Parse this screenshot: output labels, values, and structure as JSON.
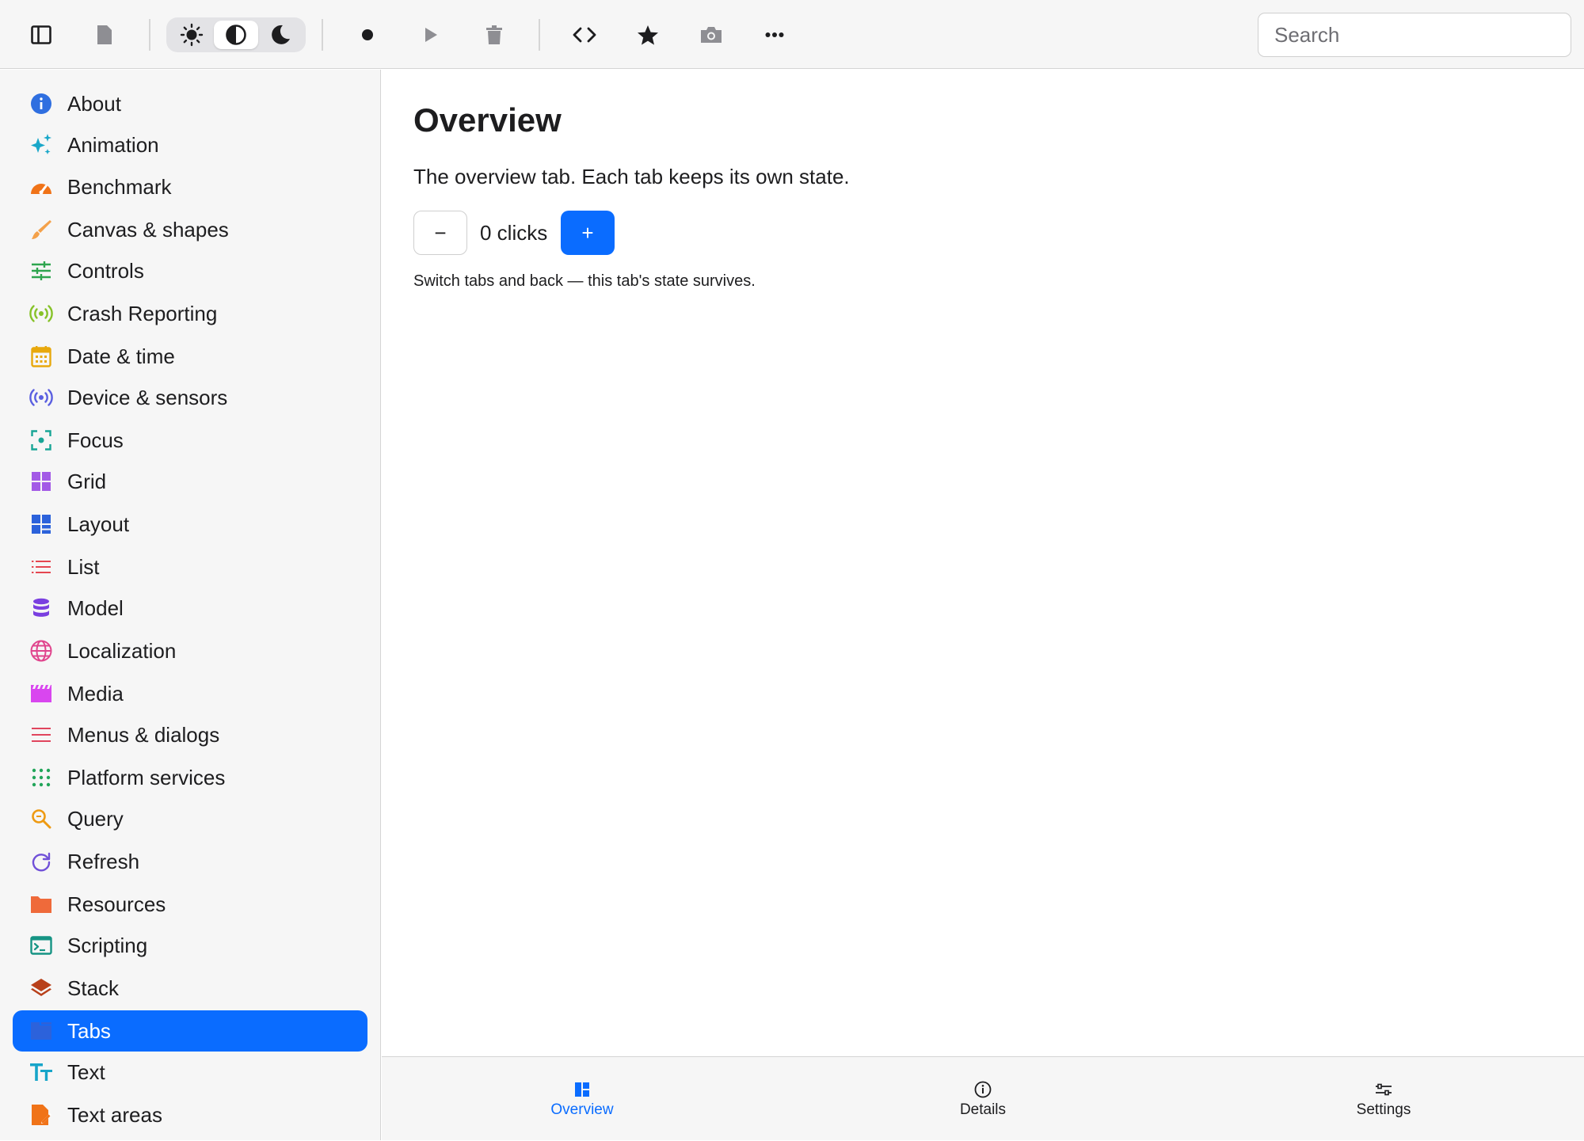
{
  "toolbar": {
    "icons": [
      "sidebar-toggle-icon",
      "document-icon",
      "sun-icon",
      "contrast-icon",
      "moon-icon",
      "record-icon",
      "play-icon",
      "trash-icon",
      "code-icon",
      "star-icon",
      "camera-icon",
      "more-icon"
    ],
    "appearance_selected": "contrast",
    "search_placeholder": "Search",
    "search_value": ""
  },
  "sidebar": {
    "selected": "Tabs",
    "items": [
      {
        "label": "About",
        "icon": "info-icon",
        "color": "#2f6fe0"
      },
      {
        "label": "Animation",
        "icon": "sparkles-icon",
        "color": "#19a7c9"
      },
      {
        "label": "Benchmark",
        "icon": "gauge-icon",
        "color": "#f07318"
      },
      {
        "label": "Canvas & shapes",
        "icon": "brush-icon",
        "color": "#f4a14a"
      },
      {
        "label": "Controls",
        "icon": "sliders-icon",
        "color": "#2ea54f"
      },
      {
        "label": "Crash Reporting",
        "icon": "antenna-icon",
        "color": "#86c228"
      },
      {
        "label": "Date & time",
        "icon": "calendar-icon",
        "color": "#e8a80c"
      },
      {
        "label": "Device & sensors",
        "icon": "sensor-icon",
        "color": "#5a5fe0"
      },
      {
        "label": "Focus",
        "icon": "focus-icon",
        "color": "#17a596"
      },
      {
        "label": "Grid",
        "icon": "grid-icon",
        "color": "#a35ae6"
      },
      {
        "label": "Layout",
        "icon": "layout-icon",
        "color": "#2c62db"
      },
      {
        "label": "List",
        "icon": "list-icon",
        "color": "#e54650"
      },
      {
        "label": "Model",
        "icon": "database-icon",
        "color": "#7a3fe0"
      },
      {
        "label": "Localization",
        "icon": "globe-icon",
        "color": "#e0458d"
      },
      {
        "label": "Media",
        "icon": "clapperboard-icon",
        "color": "#d946ef"
      },
      {
        "label": "Menus & dialogs",
        "icon": "menu-icon",
        "color": "#e0455d"
      },
      {
        "label": "Platform services",
        "icon": "dots-grid-icon",
        "color": "#22a55a"
      },
      {
        "label": "Query",
        "icon": "search-icon",
        "color": "#ee9a12"
      },
      {
        "label": "Refresh",
        "icon": "refresh-icon",
        "color": "#7050d8"
      },
      {
        "label": "Resources",
        "icon": "folder-icon",
        "color": "#ef6a3a"
      },
      {
        "label": "Scripting",
        "icon": "terminal-icon",
        "color": "#169484"
      },
      {
        "label": "Stack",
        "icon": "layers-icon",
        "color": "#b8401a"
      },
      {
        "label": "Tabs",
        "icon": "tabs-icon",
        "color": "#2c62db"
      },
      {
        "label": "Text",
        "icon": "text-icon",
        "color": "#17a5c9"
      },
      {
        "label": "Text areas",
        "icon": "document-edit-icon",
        "color": "#f07318"
      }
    ]
  },
  "main": {
    "title": "Overview",
    "description": "The overview tab. Each tab keeps its own state.",
    "minus_label": "−",
    "click_count": "0 clicks",
    "plus_label": "+",
    "note": "Switch tabs and back — this tab's state survives."
  },
  "tabbar": {
    "active": "Overview",
    "tabs": [
      {
        "label": "Overview",
        "icon": "overview-icon"
      },
      {
        "label": "Details",
        "icon": "info-circle-icon"
      },
      {
        "label": "Settings",
        "icon": "settings-sliders-icon"
      }
    ]
  },
  "colors": {
    "accent": "#0a6cff",
    "chrome_background": "#f6f6f6",
    "border": "#d4d4d4"
  }
}
